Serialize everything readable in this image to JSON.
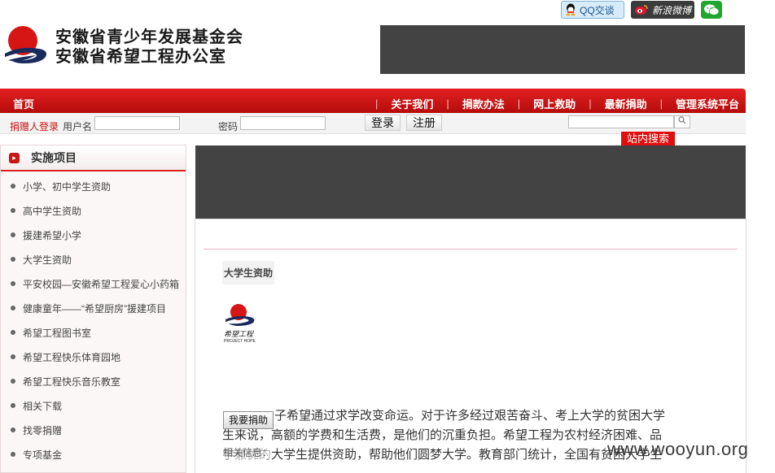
{
  "social": {
    "qq_label": "QQ交谈",
    "weibo_label": "新浪微博",
    "wechat_icon": "wechat-icon"
  },
  "header": {
    "org_line1": "安徽省青少年发展基金会",
    "org_line2": "安徽省希望工程办公室"
  },
  "nav": {
    "home": "首页",
    "items": [
      "关于我们",
      "捐款办法",
      "网上救助",
      "最新捐助",
      "管理系统平台"
    ],
    "separator": "|"
  },
  "login": {
    "title": "捐赠人登录",
    "username_label": "用户名",
    "password_label": "密码",
    "login_button": "登录",
    "register_button": "注册",
    "search_label": "站内搜索"
  },
  "sidebar": {
    "title": "实施项目",
    "items": [
      "小学、初中学生资助",
      "高中学生资助",
      "援建希望小学",
      "大学生资助",
      "平安校园—安徽希望工程爱心小药箱",
      "健康童年——“希望厨房”援建项目",
      "希望工程图书室",
      "希望工程快乐体育园地",
      "希望工程快乐音乐教室",
      "相关下载",
      "找零捐赠",
      "专项基金"
    ]
  },
  "article": {
    "title": "大学生资助",
    "logo_text": "希望工程",
    "logo_subtext": "PROJECT HOPE",
    "text_line1": "子希望通过求学改变命运。对于许多经过艰苦奋斗、考上大学的贫困大学",
    "text_line2": "生来说，高额的学费和生活费，是他们的沉重负担。希望工程为农村经济困难、品",
    "text_line3": "学兼优的大学生提供资助，帮助他们圆梦大学。教育部门统计，全国有贫困大学生",
    "donate_button": "我要捐助",
    "related_label": "相关信息："
  },
  "watermark": "www.wooyun.org",
  "colors": {
    "nav_red": "#d81e1e",
    "banner_gray": "#434343",
    "search_red": "#e00e0e"
  }
}
